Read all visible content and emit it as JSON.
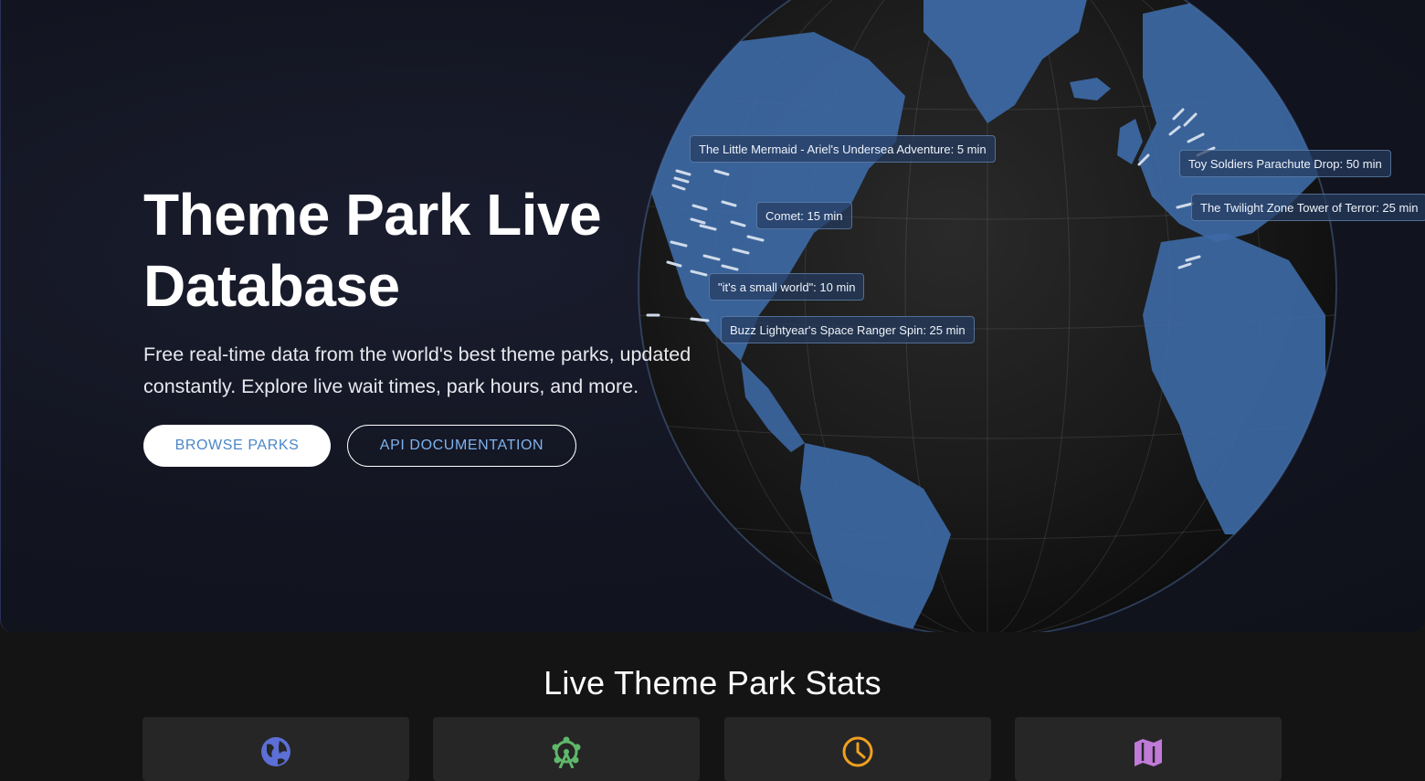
{
  "hero": {
    "title": "Theme Park Live Database",
    "subtitle": "Free real-time data from the world's best theme parks, updated constantly. Explore live wait times, park hours, and more.",
    "buttons": {
      "browse": "BROWSE PARKS",
      "api": "API DOCUMENTATION"
    }
  },
  "globe": {
    "tooltips": [
      "The Little Mermaid - Ariel's Undersea Adventure: 5 min",
      "Toy Soldiers Parachute Drop: 50 min",
      "Comet: 15 min",
      "The Twilight Zone Tower of Terror: 25 min",
      "\"it's a small world\": 10 min",
      "Buzz Lightyear's Space Ranger Spin: 25 min"
    ],
    "ocean_color": "#1a1a1a",
    "land_color": "#3d6aa6"
  },
  "stats": {
    "title": "Live Theme Park Stats",
    "cards": [
      {
        "icon": "globe-icon",
        "color": "#5b6fd6"
      },
      {
        "icon": "ferris-wheel-icon",
        "color": "#5fb86a"
      },
      {
        "icon": "clock-icon",
        "color": "#f0a020"
      },
      {
        "icon": "map-icon",
        "color": "#c07ad8"
      }
    ]
  }
}
